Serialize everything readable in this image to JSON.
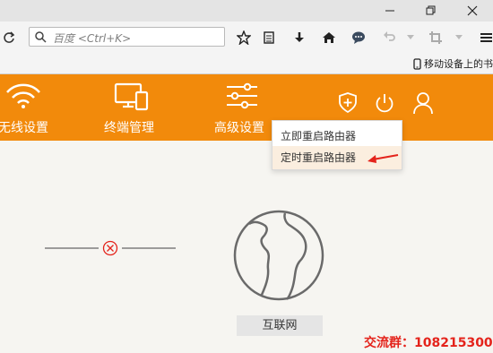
{
  "browser": {
    "url_placeholder": "百度 <Ctrl+K>",
    "mobile_bookmarks": "移动设备上的书"
  },
  "router_nav": {
    "items": [
      {
        "label": "无线设置",
        "icon": "wifi-icon"
      },
      {
        "label": "终端管理",
        "icon": "devices-icon"
      },
      {
        "label": "高级设置",
        "icon": "sliders-icon"
      }
    ],
    "right_icons": [
      "shield-plus-icon",
      "power-icon",
      "user-icon"
    ]
  },
  "power_menu": {
    "items": [
      "立即重启路由器",
      "定时重启路由器"
    ],
    "highlighted_index": 1
  },
  "status": {
    "internet_label": "互联网",
    "connection": "disconnected"
  },
  "watermark": {
    "text": "交流群：108215300"
  },
  "colors": {
    "brand": "#f28a0b",
    "error": "#e4231b"
  }
}
